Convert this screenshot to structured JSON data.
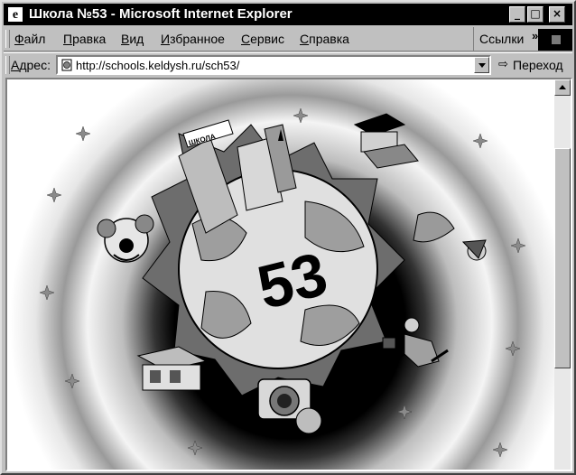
{
  "window": {
    "title": "Школа №53 - Microsoft Internet Explorer",
    "app_icon": "ie-logo-icon",
    "controls": [
      "minimize-icon",
      "maximize-icon",
      "close-icon"
    ]
  },
  "menu": {
    "items": [
      "Файл",
      "Правка",
      "Вид",
      "Избранное",
      "Сервис",
      "Справка"
    ],
    "hotkeys": [
      "Ф",
      "П",
      "В",
      "И",
      "С",
      "С"
    ],
    "links_label": "Ссылки",
    "links_chevron": "»"
  },
  "address_bar": {
    "label": "Адрес:",
    "url": "http://schools.keldysh.ru/sch53/",
    "go_label": "Переход"
  },
  "page": {
    "emblem_number": "53",
    "building_sign": "ШКОЛА",
    "images": [
      "clown-icon",
      "bookshelf-icon",
      "city-buildings-icon",
      "graduation-cap-icon",
      "dragon-icon",
      "runner-icon",
      "camera-icon",
      "shop-icon"
    ]
  },
  "colors": {
    "titlebar": "#000000",
    "chrome": "#c0c0c0",
    "content": "#ffffff"
  }
}
